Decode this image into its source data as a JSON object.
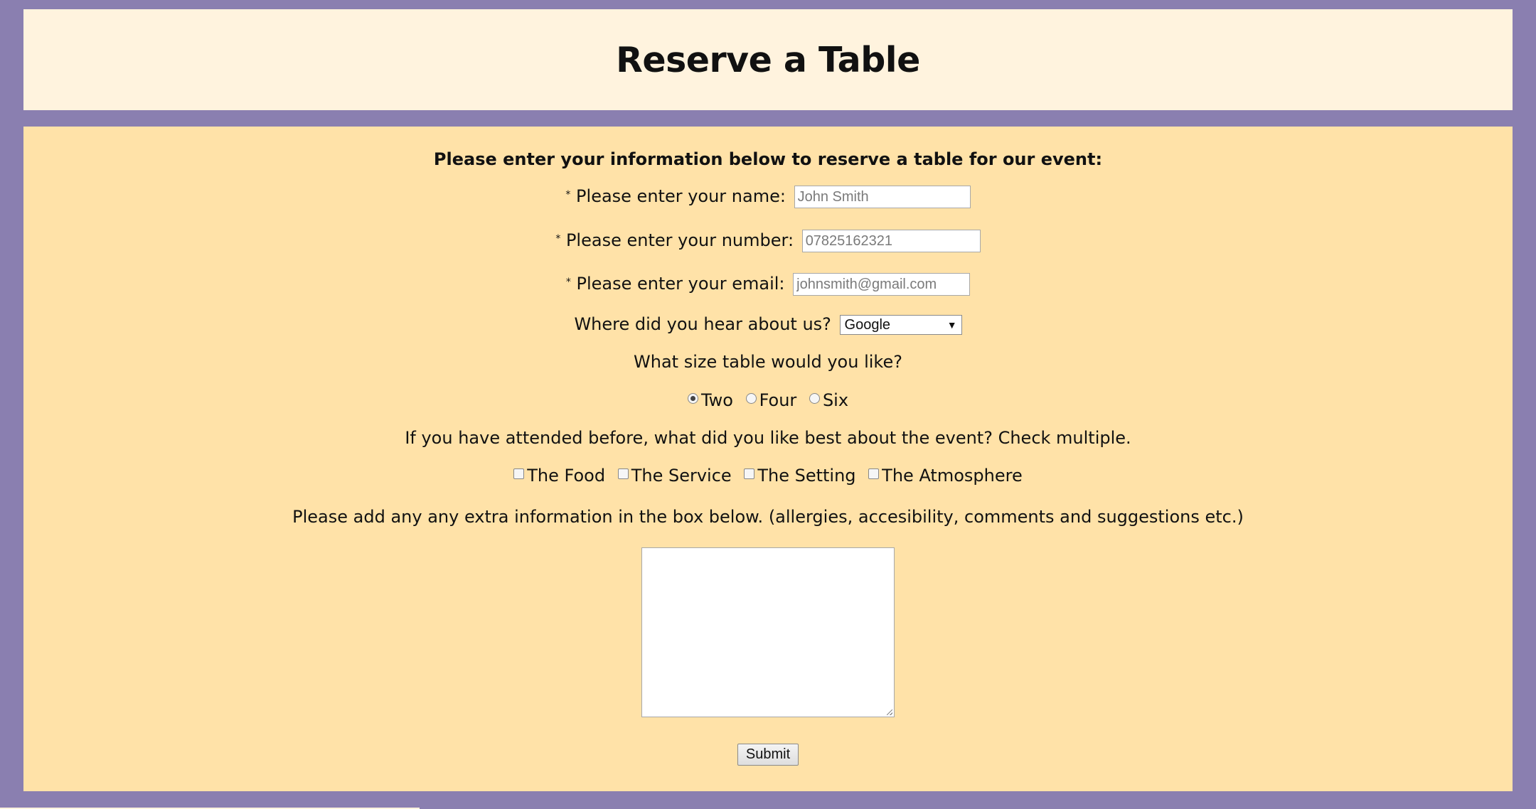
{
  "header": {
    "title": "Reserve a Table"
  },
  "form": {
    "intro": "Please enter your information below to reserve a table for our event:",
    "required_marker": "*",
    "name": {
      "label": "Please enter your name:",
      "placeholder": "John Smith",
      "value": ""
    },
    "number": {
      "label": "Please enter your number:",
      "placeholder": "07825162321",
      "value": ""
    },
    "email": {
      "label": "Please enter your email:",
      "placeholder": "johnsmith@gmail.com",
      "value": ""
    },
    "hear": {
      "label": "Where did you hear about us?",
      "selected": "Google",
      "arrow": "▼"
    },
    "size": {
      "label": "What size table would you like?",
      "options": [
        "Two",
        "Four",
        "Six"
      ],
      "selected": "Two"
    },
    "liked": {
      "label": "If you have attended before, what did you like best about the event? Check multiple.",
      "options": [
        "The Food",
        "The Service",
        "The Setting",
        "The Atmosphere"
      ],
      "checked": []
    },
    "extra": {
      "label": "Please add any any extra information in the box below. (allergies, accesibility, comments and suggestions etc.)",
      "value": ""
    },
    "submit_label": "Submit"
  },
  "colors": {
    "page_background": "#8a7fb0",
    "header_background": "#fff3de",
    "form_background": "#ffe2a8"
  }
}
